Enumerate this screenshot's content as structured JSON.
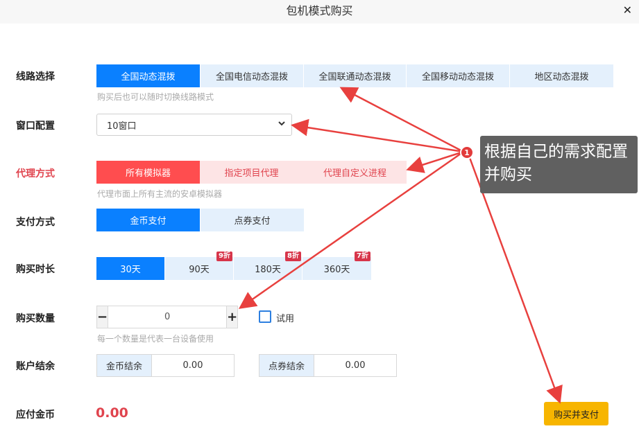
{
  "dialog": {
    "title": "包机模式购买",
    "close_symbol": "✕"
  },
  "line": {
    "label": "线路选择",
    "options": [
      "全国动态混拨",
      "全国电信动态混拨",
      "全国联通动态混拨",
      "全国移动动态混拨",
      "地区动态混拨"
    ],
    "active_index": 0,
    "hint": "购买后也可以随时切换线路模式"
  },
  "window": {
    "label": "窗口配置",
    "selected": "10窗口"
  },
  "proxy": {
    "label": "代理方式",
    "options": [
      "所有模拟器",
      "指定项目代理",
      "代理自定义进程"
    ],
    "active_index": 0,
    "hint": "代理市面上所有主流的安卓模拟器"
  },
  "payment": {
    "label": "支付方式",
    "options": [
      "金币支付",
      "点券支付"
    ],
    "active_index": 0
  },
  "duration": {
    "label": "购买时长",
    "options": [
      {
        "label": "30天",
        "badge": ""
      },
      {
        "label": "90天",
        "badge": "9折"
      },
      {
        "label": "180天",
        "badge": "8折"
      },
      {
        "label": "360天",
        "badge": "7折"
      }
    ],
    "active_index": 0
  },
  "quantity": {
    "label": "购买数量",
    "minus": "−",
    "plus": "+",
    "value": "0",
    "trial_label": "试用",
    "hint": "每一个数量是代表一台设备使用"
  },
  "balance": {
    "label": "账户结余",
    "gold_label": "金币结余",
    "gold_value": "0.00",
    "coupon_label": "点券结余",
    "coupon_value": "0.00"
  },
  "total": {
    "label": "应付金币",
    "value": "0.00"
  },
  "submit": {
    "label": "购买并支付"
  },
  "annotation": {
    "number": "1",
    "text": "根据自己的需求配置并购买",
    "arrow_color": "#e8403e"
  },
  "colors": {
    "primary_blue": "#0a80ff",
    "light_blue": "#e4f0fc",
    "red": "#ff4d4f",
    "light_red": "#fde4e5",
    "pay_yellow": "#f7b500",
    "badge_red": "#d7354a"
  }
}
